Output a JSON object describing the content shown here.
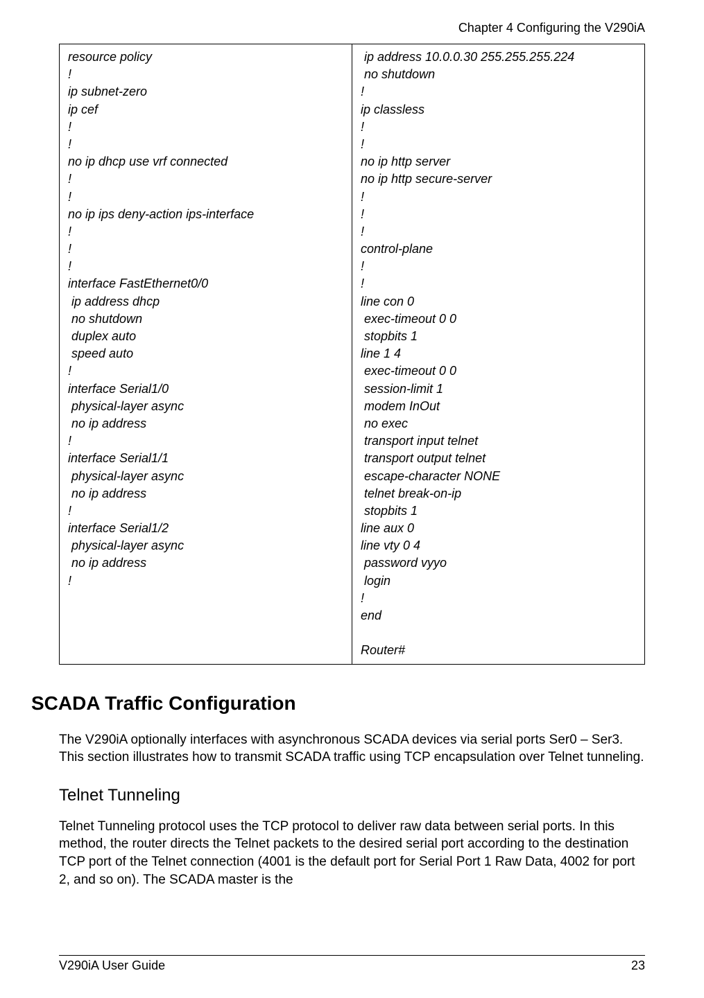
{
  "chapter_header": "Chapter 4  Configuring the V290iA",
  "config_left": "resource policy\n!\nip subnet-zero\nip cef\n!\n!\nno ip dhcp use vrf connected\n!\n!\nno ip ips deny-action ips-interface\n!\n!\n!\ninterface FastEthernet0/0\n ip address dhcp\n no shutdown\n duplex auto\n speed auto\n!\ninterface Serial1/0\n physical-layer async\n no ip address\n!\ninterface Serial1/1\n physical-layer async\n no ip address\n!\ninterface Serial1/2\n physical-layer async\n no ip address\n!",
  "config_right": " ip address 10.0.0.30 255.255.255.224\n no shutdown\n!\nip classless\n!\n!\nno ip http server\nno ip http secure-server\n!\n!\n!\ncontrol-plane\n!\n!\nline con 0\n exec-timeout 0 0\n stopbits 1\nline 1 4\n exec-timeout 0 0\n session-limit 1\n modem InOut\n no exec\n transport input telnet\n transport output telnet\n escape-character NONE\n telnet break-on-ip\n stopbits 1\nline aux 0\nline vty 0 4\n password vyyo\n login\n!\nend\n\nRouter#",
  "section": {
    "heading": "SCADA Traffic Configuration",
    "intro": "The V290iA optionally interfaces with asynchronous SCADA devices via serial ports Ser0 – Ser3. This section illustrates how to transmit SCADA traffic using TCP encapsulation over Telnet tunneling.",
    "sub_heading": "Telnet Tunneling",
    "sub_body": "Telnet Tunneling protocol uses the TCP protocol to deliver raw data between serial ports. In this method, the router directs the Telnet packets to the desired serial port according to the destination TCP port of the Telnet connection (4001 is the default port for Serial Port 1 Raw Data, 4002 for port 2, and so on). The SCADA master is the"
  },
  "footer": {
    "left": "V290iA User Guide",
    "right": "23"
  }
}
